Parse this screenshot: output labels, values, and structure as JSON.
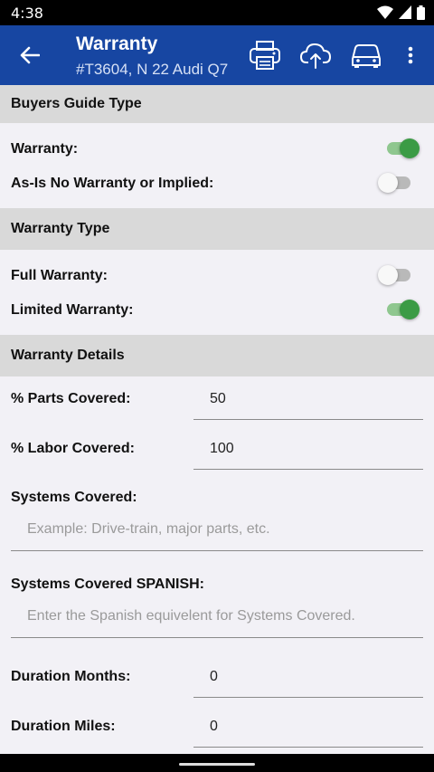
{
  "status_bar": {
    "time": "4:38"
  },
  "app_bar": {
    "title": "Warranty",
    "subtitle": "#T3604, N 22 Audi Q7",
    "actions": [
      "print-icon",
      "cloud-upload-icon",
      "car-icon",
      "more-vert-icon"
    ]
  },
  "sections": {
    "buyers_guide_type": {
      "title": "Buyers Guide Type",
      "warranty_label": "Warranty:",
      "warranty_on": true,
      "as_is_label": "As-Is No Warranty or Implied:",
      "as_is_on": false
    },
    "warranty_type": {
      "title": "Warranty Type",
      "full_label": "Full Warranty:",
      "full_on": false,
      "limited_label": "Limited Warranty:",
      "limited_on": true
    },
    "warranty_details": {
      "title": "Warranty Details",
      "parts_label": "% Parts Covered:",
      "parts_value": "50",
      "labor_label": "% Labor Covered:",
      "labor_value": "100",
      "systems_label": "Systems Covered:",
      "systems_placeholder": "Example: Drive-train, major parts, etc.",
      "systems_es_label": "Systems Covered SPANISH:",
      "systems_es_placeholder": "Enter the Spanish equivelent for Systems Covered.",
      "months_label": "Duration Months:",
      "months_value": "0",
      "miles_label": "Duration Miles:",
      "miles_value": "0"
    }
  },
  "colors": {
    "app_bar": "#1746a2",
    "switch_on": "#3b9b45",
    "section_header": "#d9d9d9"
  }
}
